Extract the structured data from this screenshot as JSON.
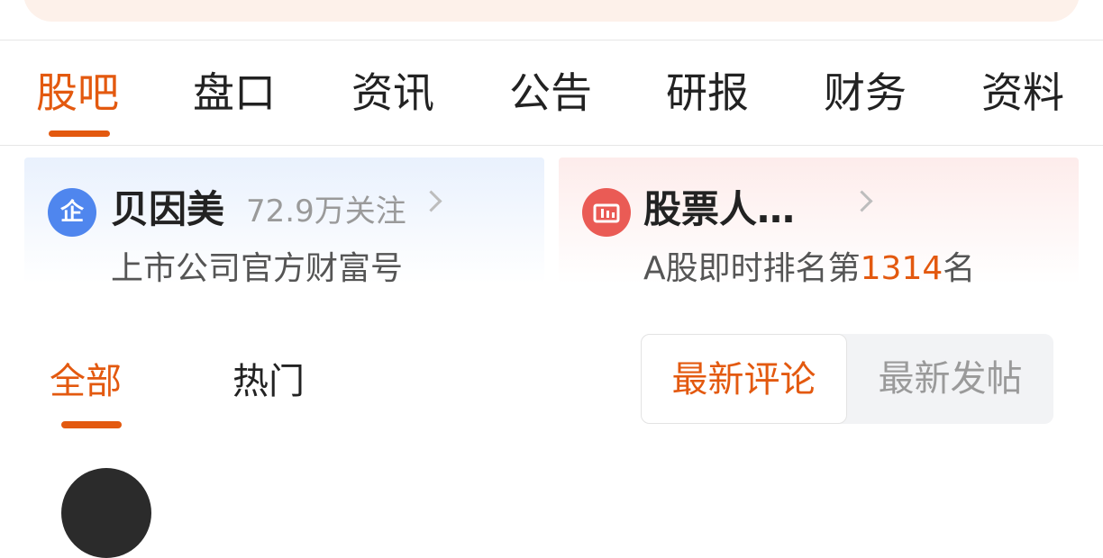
{
  "main_tabs": [
    {
      "label": "股吧",
      "active": true
    },
    {
      "label": "盘口",
      "active": false
    },
    {
      "label": "资讯",
      "active": false
    },
    {
      "label": "公告",
      "active": false
    },
    {
      "label": "研报",
      "active": false
    },
    {
      "label": "财务",
      "active": false
    },
    {
      "label": "资料",
      "active": false
    }
  ],
  "company_card": {
    "badge_text": "企",
    "name": "贝因美",
    "followers": "72.9万关注",
    "subtitle": "上市公司官方财富号"
  },
  "ranking_card": {
    "title": "股票人…",
    "rank_prefix": "A股即时排名第",
    "rank_number": "1314",
    "rank_suffix": "名"
  },
  "sub_tabs": [
    {
      "label": "全部",
      "active": true
    },
    {
      "label": "热门",
      "active": false
    }
  ],
  "sort_toggle": {
    "options": [
      {
        "label": "最新评论",
        "active": true
      },
      {
        "label": "最新发帖",
        "active": false
      }
    ]
  },
  "colors": {
    "accent": "#e3590f",
    "badge_blue": "#4f86ee",
    "badge_red": "#ea5b55"
  },
  "icons": {
    "company_badge": "enterprise-badge-icon",
    "ranking_badge": "bar-chart-icon",
    "chevron": "chevron-right-icon"
  }
}
